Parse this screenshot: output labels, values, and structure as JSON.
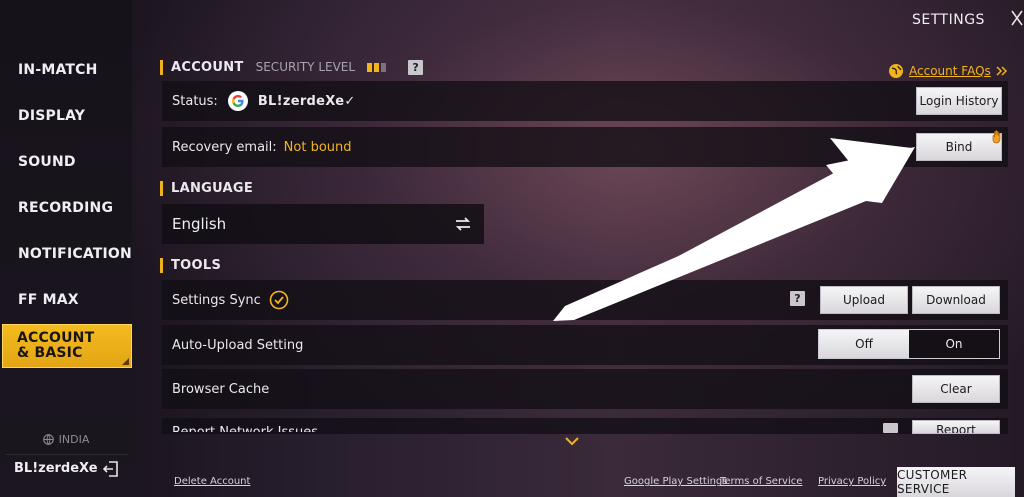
{
  "header": {
    "title": "SETTINGS"
  },
  "sidebar": {
    "items": [
      {
        "label": "IN-MATCH"
      },
      {
        "label": "DISPLAY"
      },
      {
        "label": "SOUND"
      },
      {
        "label": "RECORDING"
      },
      {
        "label": "NOTIFICATION"
      },
      {
        "label": "FF MAX"
      },
      {
        "label": "ACCOUNT & BASIC",
        "active": true
      }
    ],
    "region": "INDIA",
    "username": "BL!zerdeXe"
  },
  "account": {
    "heading": "ACCOUNT",
    "security_label": "SECURITY LEVEL",
    "security_level": 2,
    "security_max": 3,
    "help": "?",
    "faq_link": "Account FAQs",
    "status_label": "Status:",
    "username": "BL!zerdeXe✓",
    "login_history_button": "Login History",
    "recovery_label": "Recovery email:",
    "recovery_value": "Not bound",
    "bind_button": "Bind"
  },
  "language": {
    "heading": "LANGUAGE",
    "selected": "English"
  },
  "tools": {
    "heading": "TOOLS",
    "settings_sync_label": "Settings Sync",
    "help": "?",
    "upload_button": "Upload",
    "download_button": "Download",
    "auto_upload_label": "Auto-Upload Setting",
    "toggle_off": "Off",
    "toggle_on": "On",
    "auto_upload_state": "On",
    "browser_cache_label": "Browser Cache",
    "clear_button": "Clear",
    "report_network_label": "Report Network Issues",
    "report_button": "Report"
  },
  "footer": {
    "delete_account": "Delete Account",
    "google_play_settings": "Google Play Settings",
    "terms": "Terms of Service",
    "privacy": "Privacy Policy",
    "customer_service": "CUSTOMER SERVICE"
  },
  "colors": {
    "accent": "#f2b41d",
    "sidebar_active": "#f4bb1f",
    "row_bg": "#120e14"
  }
}
